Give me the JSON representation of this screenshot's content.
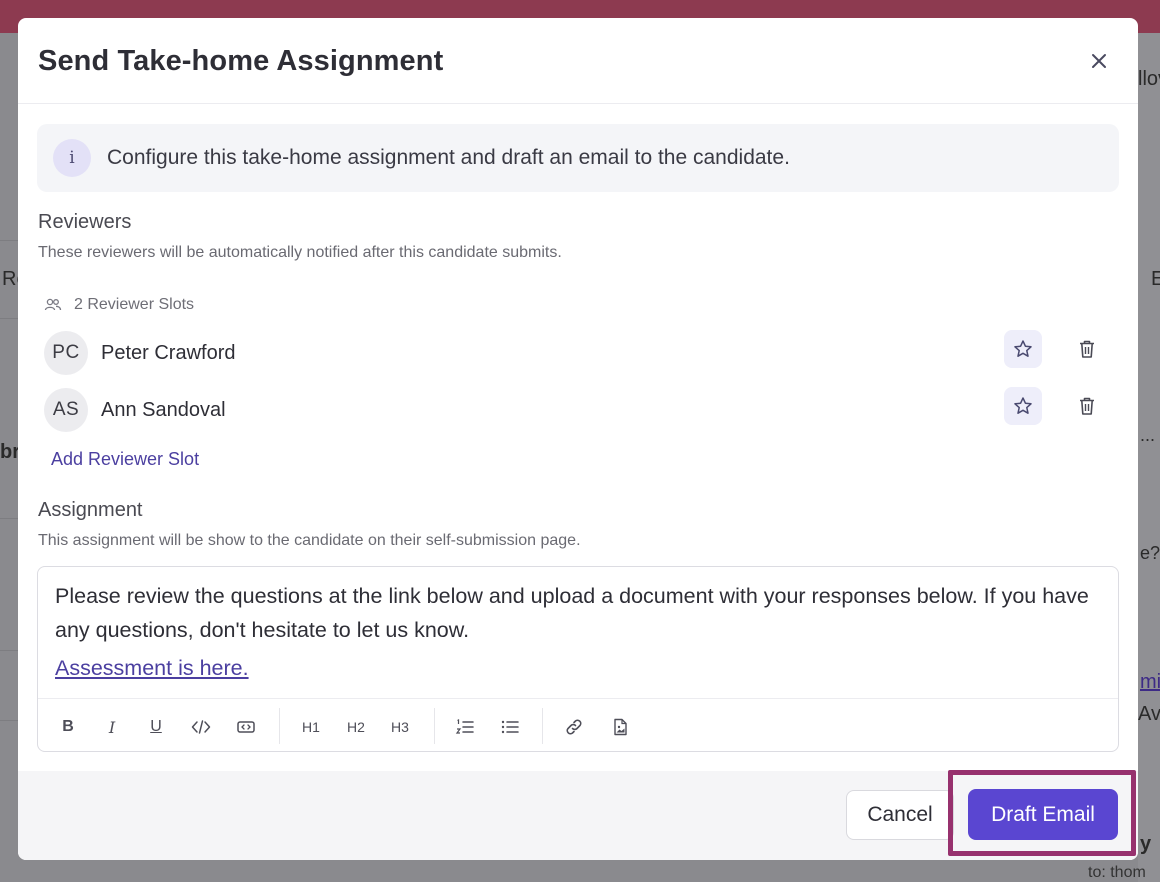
{
  "background": {
    "fragments": [
      "llov",
      "Re",
      "E",
      "br",
      "...",
      "e?",
      "mit",
      "Ave",
      "y",
      "to: thom"
    ]
  },
  "modal": {
    "title": "Send Take-home Assignment",
    "close_icon": "close-icon",
    "info": {
      "icon": "info-icon",
      "icon_glyph": "i",
      "text": "Configure this take-home assignment and draft an email to the candidate."
    },
    "reviewers": {
      "title": "Reviewers",
      "description": "These reviewers will be automatically notified after this candidate submits.",
      "slots_label": "2 Reviewer Slots",
      "items": [
        {
          "initials": "PC",
          "name": "Peter Crawford"
        },
        {
          "initials": "AS",
          "name": "Ann Sandoval"
        }
      ],
      "add_label": "Add Reviewer Slot"
    },
    "assignment": {
      "title": "Assignment",
      "description": "This assignment will be show to the candidate on their self-submission page.",
      "body": "Please review the questions at the link below and upload a document with your responses below. If you have any questions, don't hesitate to let us know.",
      "link_text": "Assessment is here.",
      "toolbar": {
        "bold": "B",
        "italic": "I",
        "underline": "U",
        "h1": "H1",
        "h2": "H2",
        "h3": "H3"
      }
    },
    "footer": {
      "cancel_label": "Cancel",
      "draft_label": "Draft Email"
    }
  },
  "colors": {
    "accent": "#5a46d1",
    "highlight": "#97316e",
    "link": "#4b3fa0",
    "topbar": "#8d3a50"
  }
}
